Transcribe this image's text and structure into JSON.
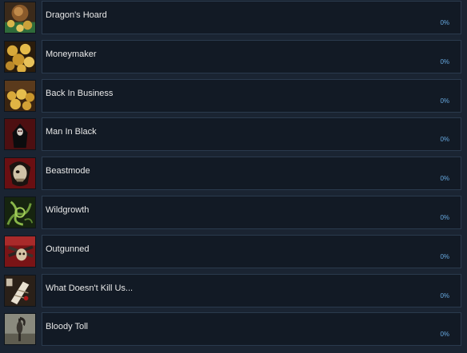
{
  "achievements": [
    {
      "name": "Dragon's Hoard",
      "percent": "0%",
      "icon": "treasure-hoard-icon"
    },
    {
      "name": "Moneymaker",
      "percent": "0%",
      "icon": "gold-coins-icon"
    },
    {
      "name": "Back In Business",
      "percent": "0%",
      "icon": "gold-pile-icon"
    },
    {
      "name": "Man In Black",
      "percent": "0%",
      "icon": "hooded-figure-icon"
    },
    {
      "name": "Beastmode",
      "percent": "0%",
      "icon": "beast-skull-icon"
    },
    {
      "name": "Wildgrowth",
      "percent": "0%",
      "icon": "vines-icon"
    },
    {
      "name": "Outgunned",
      "percent": "0%",
      "icon": "crossed-guns-icon"
    },
    {
      "name": "What Doesn't Kill Us...",
      "percent": "0%",
      "icon": "bandaged-arm-icon"
    },
    {
      "name": "Bloody Toll",
      "percent": "0%",
      "icon": "scythe-icon"
    }
  ],
  "colors": {
    "page_background": "#1a2432",
    "panel_background": "#121a25",
    "panel_border": "#2a3a4d",
    "name_text": "#e8e8e8",
    "percent_text": "#67a9e0"
  }
}
